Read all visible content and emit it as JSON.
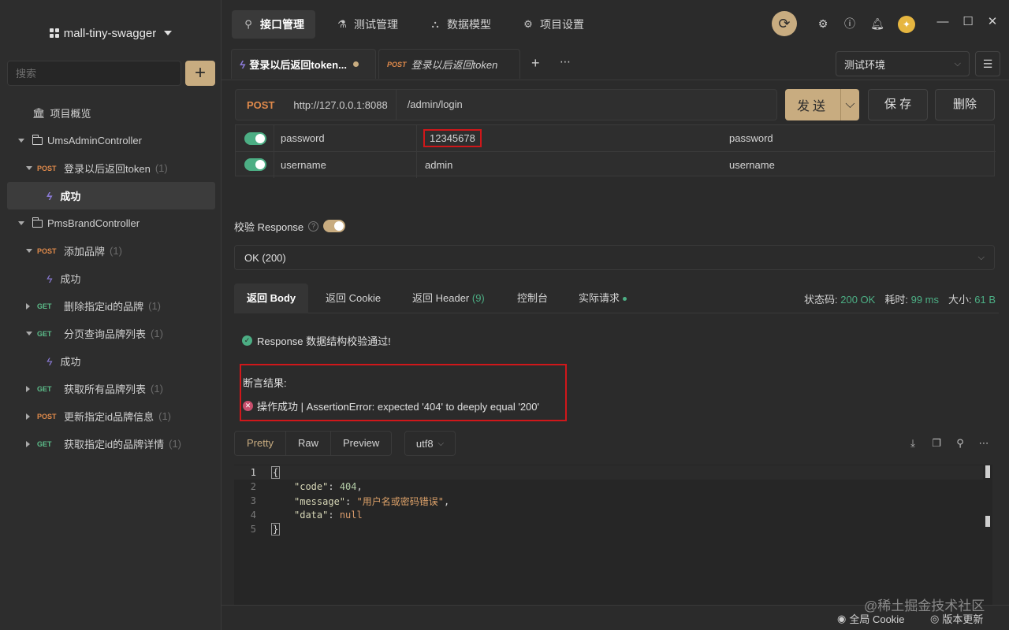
{
  "sidebar": {
    "project_title": "mall-tiny-swagger",
    "search_placeholder": "搜索",
    "add_label": "+",
    "items": [
      {
        "label": "项目概览"
      },
      {
        "label": "UmsAdminController"
      },
      {
        "method": "POST",
        "label": "登录以后返回token",
        "count": "(1)"
      },
      {
        "label": "成功"
      },
      {
        "label": "PmsBrandController"
      },
      {
        "method": "POST",
        "label": "添加品牌",
        "count": "(1)"
      },
      {
        "label": "成功"
      },
      {
        "method": "GET",
        "label": "删除指定id的品牌",
        "count": "(1)"
      },
      {
        "method": "GET",
        "label": "分页查询品牌列表",
        "count": "(1)"
      },
      {
        "label": "成功"
      },
      {
        "method": "GET",
        "label": "获取所有品牌列表",
        "count": "(1)"
      },
      {
        "method": "POST",
        "label": "更新指定id品牌信息",
        "count": "(1)"
      },
      {
        "method": "GET",
        "label": "获取指定id的品牌详情",
        "count": "(1)"
      }
    ]
  },
  "topnav": {
    "tabs": [
      {
        "label": "接口管理"
      },
      {
        "label": "测试管理"
      },
      {
        "label": "数据模型"
      },
      {
        "label": "项目设置"
      }
    ]
  },
  "doc_tabs": [
    {
      "label": "登录以后返回token..."
    },
    {
      "method": "POST",
      "label": "登录以后返回token"
    }
  ],
  "environment": "测试环境",
  "request": {
    "method": "POST",
    "base_url": "http://127.0.0.1:8088",
    "path": "/admin/login",
    "send_label": "发送",
    "save_label": "保 存",
    "delete_label": "删除"
  },
  "params": [
    {
      "name": "password",
      "value": "12345678",
      "description": "password"
    },
    {
      "name": "username",
      "value": "admin",
      "description": "username"
    }
  ],
  "validation": {
    "label": "校验 Response",
    "selected": "OK (200)"
  },
  "response_tabs": [
    {
      "label": "返回 Body"
    },
    {
      "label": "返回 Cookie"
    },
    {
      "label": "返回 Header",
      "badge": "(9)"
    },
    {
      "label": "控制台"
    },
    {
      "label": "实际请求"
    }
  ],
  "status": {
    "code_label": "状态码:",
    "code_value": "200 OK",
    "time_label": "耗时:",
    "time_value": "99 ms",
    "size_label": "大小:",
    "size_value": "61 B"
  },
  "result": {
    "schema_ok": "Response 数据结构校验通过!",
    "assert_title": "断言结果:",
    "assert_message": "操作成功 | AssertionError: expected '404' to deeply equal '200'"
  },
  "view": {
    "tabs": [
      {
        "label": "Pretty"
      },
      {
        "label": "Raw"
      },
      {
        "label": "Preview"
      }
    ],
    "encoding": "utf8"
  },
  "code_lines": [
    {
      "num": "1"
    },
    {
      "num": "2",
      "key": "\"code\"",
      "value": "404",
      "tail": ","
    },
    {
      "num": "3",
      "key": "\"message\"",
      "value": "\"用户名或密码错误\"",
      "tail": ","
    },
    {
      "num": "4",
      "key": "\"data\"",
      "value": "null",
      "tail": ""
    },
    {
      "num": "5"
    }
  ],
  "code_braces": {
    "open": "{",
    "close": "}"
  },
  "footer": {
    "watermark": "@稀土掘金技术社区",
    "cookie_label": "全局 Cookie",
    "update_label": "版本更新"
  },
  "colors": {
    "accent": "#c8ac80",
    "post": "#e08a4b",
    "get": "#5cbd8a",
    "success": "#4cae84",
    "highlight_box": "#d0171a"
  }
}
